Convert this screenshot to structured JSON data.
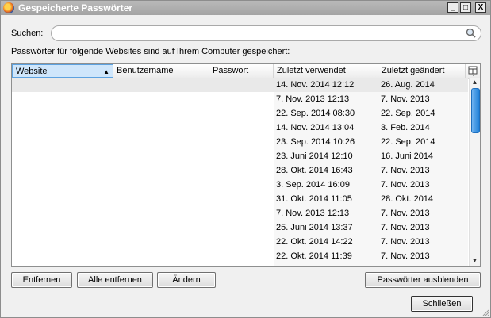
{
  "window": {
    "title": "Gespeicherte Passwörter",
    "minimize": "_",
    "maximize": "□",
    "close": "X"
  },
  "search": {
    "label": "Suchen:",
    "value": "",
    "placeholder": ""
  },
  "info_text": "Passwörter für folgende Websites sind auf Ihrem Computer gespeichert:",
  "table": {
    "columns": [
      "Website",
      "Benutzername",
      "Passwort",
      "Zuletzt verwendet",
      "Zuletzt geändert"
    ],
    "sorted_column": "Website",
    "rows": [
      {
        "website": "",
        "username": "",
        "password": "",
        "last_used": "14. Nov. 2014 12:12",
        "last_changed": "26. Aug. 2014"
      },
      {
        "website": "",
        "username": "",
        "password": "",
        "last_used": "7. Nov. 2013 12:13",
        "last_changed": "7. Nov. 2013"
      },
      {
        "website": "",
        "username": "",
        "password": "",
        "last_used": "22. Sep. 2014 08:30",
        "last_changed": "22. Sep. 2014"
      },
      {
        "website": "",
        "username": "",
        "password": "",
        "last_used": "14. Nov. 2014 13:04",
        "last_changed": "3. Feb. 2014"
      },
      {
        "website": "",
        "username": "",
        "password": "",
        "last_used": "23. Sep. 2014 10:26",
        "last_changed": "22. Sep. 2014"
      },
      {
        "website": "",
        "username": "",
        "password": "",
        "last_used": "23. Juni 2014 12:10",
        "last_changed": "16. Juni 2014"
      },
      {
        "website": "",
        "username": "",
        "password": "",
        "last_used": "28. Okt. 2014 16:43",
        "last_changed": "7. Nov. 2013"
      },
      {
        "website": "",
        "username": "",
        "password": "",
        "last_used": "3. Sep. 2014 16:09",
        "last_changed": "7. Nov. 2013"
      },
      {
        "website": "",
        "username": "",
        "password": "",
        "last_used": "31. Okt. 2014 11:05",
        "last_changed": "28. Okt. 2014"
      },
      {
        "website": "",
        "username": "",
        "password": "",
        "last_used": "7. Nov. 2013 12:13",
        "last_changed": "7. Nov. 2013"
      },
      {
        "website": "",
        "username": "",
        "password": "",
        "last_used": "25. Juni 2014 13:37",
        "last_changed": "7. Nov. 2013"
      },
      {
        "website": "",
        "username": "",
        "password": "",
        "last_used": "22. Okt. 2014 14:22",
        "last_changed": "7. Nov. 2013"
      },
      {
        "website": "",
        "username": "",
        "password": "",
        "last_used": "22. Okt. 2014 11:39",
        "last_changed": "7. Nov. 2013"
      }
    ]
  },
  "buttons": {
    "remove": "Entfernen",
    "remove_all": "Alle entfernen",
    "change": "Ändern",
    "hide_passwords": "Passwörter ausblenden",
    "close": "Schließen"
  },
  "colors": {
    "titlebar": "#aaaaaa",
    "accent": "#1f80d8",
    "selected_row": "#e9e9e9"
  }
}
